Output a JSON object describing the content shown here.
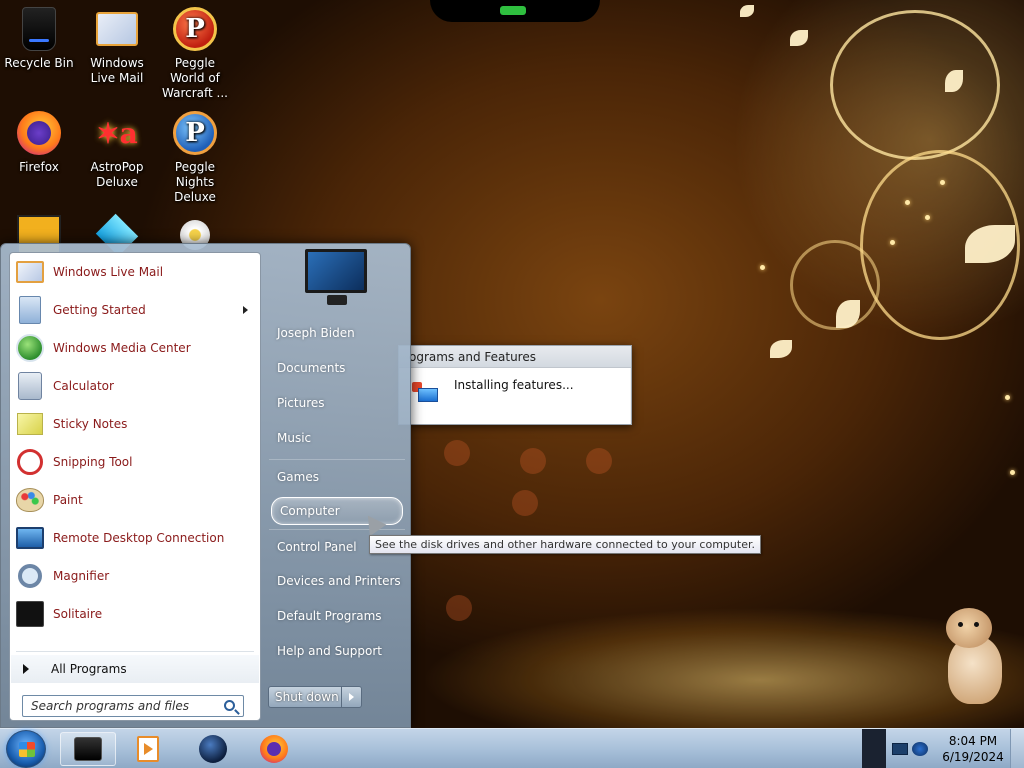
{
  "desktop": {
    "icons": [
      {
        "label": "Recycle Bin",
        "icon": "recycle-bin-icon"
      },
      {
        "label": "Windows Live Mail",
        "icon": "mail-icon"
      },
      {
        "label": "Peggle World of Warcraft ...",
        "icon": "peggle-icon"
      },
      {
        "label": "Firefox",
        "icon": "firefox-icon"
      },
      {
        "label": "AstroPop Deluxe",
        "icon": "astropop-icon"
      },
      {
        "label": "Peggle Nights Deluxe",
        "icon": "peggle-nights-icon"
      }
    ]
  },
  "progress_dialog": {
    "title": "ograms and Features",
    "status": "Installing features..."
  },
  "start_menu": {
    "programs": [
      {
        "label": "Windows Live Mail",
        "icon": "mail-icon"
      },
      {
        "label": "Getting Started",
        "icon": "getting-started-icon",
        "has_submenu": true
      },
      {
        "label": "Windows Media Center",
        "icon": "media-center-icon"
      },
      {
        "label": "Calculator",
        "icon": "calculator-icon"
      },
      {
        "label": "Sticky Notes",
        "icon": "sticky-notes-icon"
      },
      {
        "label": "Snipping Tool",
        "icon": "snipping-tool-icon"
      },
      {
        "label": "Paint",
        "icon": "paint-icon"
      },
      {
        "label": "Remote Desktop Connection",
        "icon": "remote-desktop-icon"
      },
      {
        "label": "Magnifier",
        "icon": "magnifier-icon"
      },
      {
        "label": "Solitaire",
        "icon": "solitaire-icon"
      }
    ],
    "all_programs": "All Programs",
    "search_placeholder": "Search programs and files",
    "places": [
      "Joseph Biden",
      "Documents",
      "Pictures",
      "Music",
      "Games",
      "Computer",
      "Control Panel",
      "Devices and Printers",
      "Default Programs",
      "Help and Support"
    ],
    "highlighted_place": "Computer",
    "shutdown_label": "Shut down",
    "tooltip": "See the disk drives and other hardware connected to your computer."
  },
  "taskbar": {
    "pinned": [
      {
        "icon": "windows-explorer-icon",
        "active": true
      },
      {
        "icon": "media-player-icon",
        "active": false
      },
      {
        "icon": "globe-icon",
        "active": false
      },
      {
        "icon": "firefox-icon",
        "active": false
      }
    ],
    "clock_time": "8:04 PM",
    "clock_date": "6/19/2024"
  },
  "colors": {
    "program_text": "#8a1a1a",
    "taskbar": "#a9c1da",
    "accent": "#1a5fb0"
  }
}
